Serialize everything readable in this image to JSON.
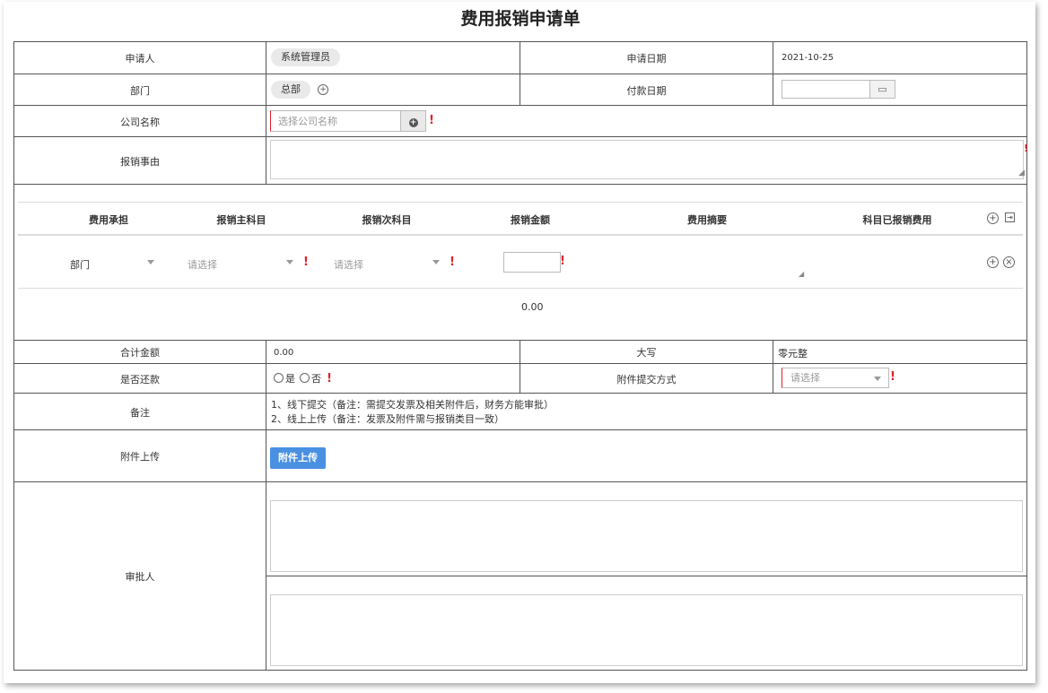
{
  "title": "费用报销申请单",
  "applicant": {
    "label": "申请人",
    "value": "系统管理员"
  },
  "apply_date": {
    "label": "申请日期",
    "value": "2021-10-25"
  },
  "department": {
    "label": "部门",
    "value": "总部"
  },
  "pay_date": {
    "label": "付款日期"
  },
  "company": {
    "label": "公司名称",
    "placeholder": "选择公司名称"
  },
  "reason": {
    "label": "报销事由"
  },
  "detail": {
    "headers": [
      "费用承担",
      "报销主科目",
      "报销次科目",
      "报销金额",
      "费用摘要",
      "科目已报销费用"
    ],
    "row": {
      "bearer": "部门",
      "main_subject_placeholder": "请选择",
      "sub_subject_placeholder": "请选择"
    },
    "subtotal": "0.00"
  },
  "total": {
    "label": "合计金额",
    "value": "0.00",
    "upper_label": "大写",
    "upper_value": "零元整"
  },
  "repay": {
    "label": "是否还款",
    "yes": "是",
    "no": "否"
  },
  "attach_method": {
    "label": "附件提交方式",
    "placeholder": "请选择"
  },
  "note": {
    "label": "备注",
    "line1": "1、线下提交（备注：需提交发票及相关附件后，财务方能审批）",
    "line2": "2、线上上传（备注：发票及附件需与报销类目一致）"
  },
  "upload": {
    "label": "附件上传",
    "button": "附件上传"
  },
  "approver": {
    "label": "审批人"
  },
  "colors": {
    "accent": "#4a90e2",
    "required": "#e0202b",
    "border": "#555555"
  }
}
